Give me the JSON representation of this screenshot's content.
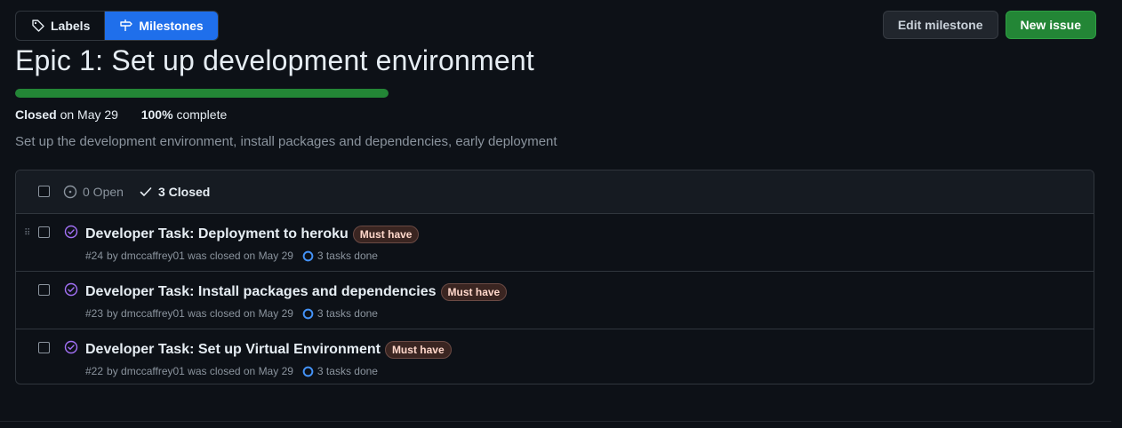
{
  "toolbar": {
    "labels_tab": "Labels",
    "milestones_tab": "Milestones",
    "edit_milestone": "Edit milestone",
    "new_issue": "New issue"
  },
  "milestone": {
    "title": "Epic 1: Set up development environment",
    "progress_percent": 100,
    "status": "Closed",
    "closed_on": "on May 29",
    "percent_label": "100%",
    "complete_label": "complete",
    "description": "Set up the development environment, install packages and dependencies, early deployment"
  },
  "issues_header": {
    "open_label": "0 Open",
    "closed_label": "3 Closed"
  },
  "issues": [
    {
      "title": "Developer Task: Deployment to heroku",
      "label": "Must have",
      "number": "#24",
      "author_line": "by dmccaffrey01 was closed on May 29",
      "tasks": "3 tasks done"
    },
    {
      "title": "Developer Task: Install packages and dependencies",
      "label": "Must have",
      "number": "#23",
      "author_line": "by dmccaffrey01 was closed on May 29",
      "tasks": "3 tasks done"
    },
    {
      "title": "Developer Task: Set up Virtual Environment",
      "label": "Must have",
      "number": "#22",
      "author_line": "by dmccaffrey01 was closed on May 29",
      "tasks": "3 tasks done"
    }
  ],
  "colors": {
    "accent_blue": "#1f6feb",
    "green": "#238636",
    "closed_purple": "#a371f7"
  }
}
